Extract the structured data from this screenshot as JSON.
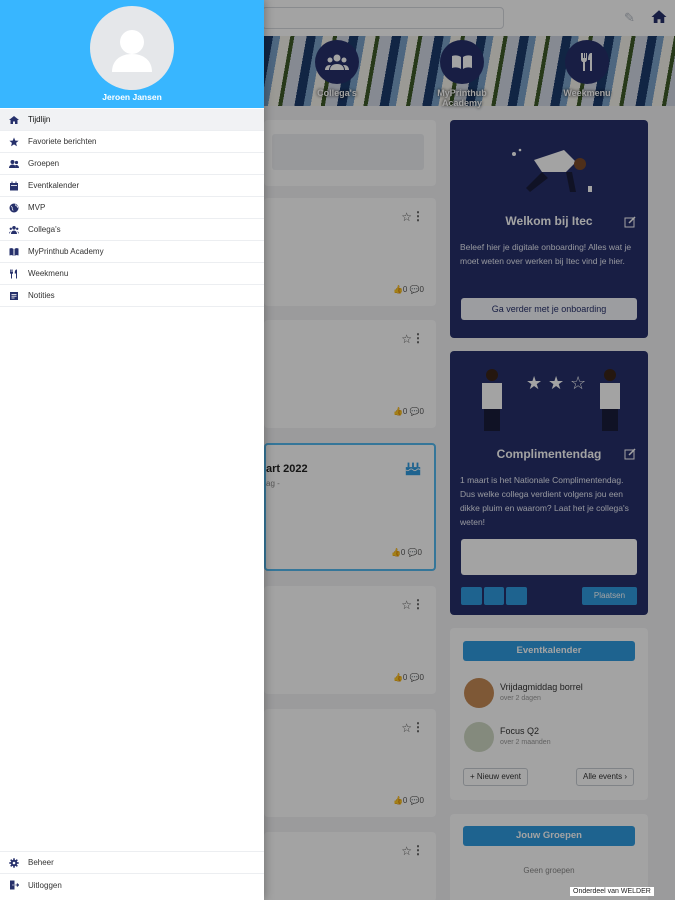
{
  "drawer": {
    "user_name": "Jeroen Jansen",
    "items": [
      {
        "label": "Tijdlijn",
        "icon": "home-icon",
        "active": true
      },
      {
        "label": "Favoriete berichten",
        "icon": "star-icon"
      },
      {
        "label": "Groepen",
        "icon": "groups-icon"
      },
      {
        "label": "Eventkalender",
        "icon": "calendar-icon"
      },
      {
        "label": "MVP",
        "icon": "globe-icon"
      },
      {
        "label": "Collega's",
        "icon": "colleagues-icon"
      },
      {
        "label": "MyPrinthub Academy",
        "icon": "book-icon"
      },
      {
        "label": "Weekmenu",
        "icon": "fork-knife-icon"
      },
      {
        "label": "Notities",
        "icon": "notes-icon"
      }
    ],
    "bottom_items": [
      {
        "label": "Beheer",
        "icon": "gear-icon"
      },
      {
        "label": "Uitloggen",
        "icon": "logout-icon"
      }
    ]
  },
  "banner": {
    "tiles": [
      {
        "label": "Collega's",
        "icon": "colleagues-icon"
      },
      {
        "label": "MyPrinthub Academy",
        "icon": "book-icon"
      },
      {
        "label": "Weekmenu",
        "icon": "fork-knife-icon"
      }
    ]
  },
  "feed": {
    "posts": [
      {
        "likes": "0",
        "comments": "0"
      },
      {
        "likes": "0",
        "comments": "0"
      },
      {
        "title": "art 2022",
        "subtitle": "ag -",
        "likes": "0",
        "comments": "0"
      },
      {
        "likes": "0",
        "comments": "0"
      },
      {
        "likes": "0",
        "comments": "0"
      }
    ]
  },
  "welcome_card": {
    "title": "Welkom bij Itec",
    "text": "Beleef hier je digitale onboarding! Alles wat je moet weten over werken bij Itec vind je hier.",
    "button": "Ga verder met je onboarding"
  },
  "compliment_card": {
    "title": "Complimentendag",
    "text": "1 maart is het Nationale Complimentendag. Dus welke collega verdient volgens jou een dikke pluim en waarom? Laat het je collega's weten!",
    "post_button": "Plaatsen"
  },
  "events_card": {
    "header": "Eventkalender",
    "events": [
      {
        "title": "Vrijdagmiddag borrel",
        "sub": "over 2 dagen"
      },
      {
        "title": "Focus Q2",
        "sub": "over 2 maanden"
      }
    ],
    "new_event": "Nieuw event",
    "all_events": "Alle events"
  },
  "groups_card": {
    "header": "Jouw Groepen",
    "empty": "Geen groepen"
  },
  "footer_note": "Onderdeel van WELDER",
  "colors": {
    "drawer_header": "#38b6ff",
    "navy": "#26306b",
    "accent_blue": "#2f9be0"
  }
}
